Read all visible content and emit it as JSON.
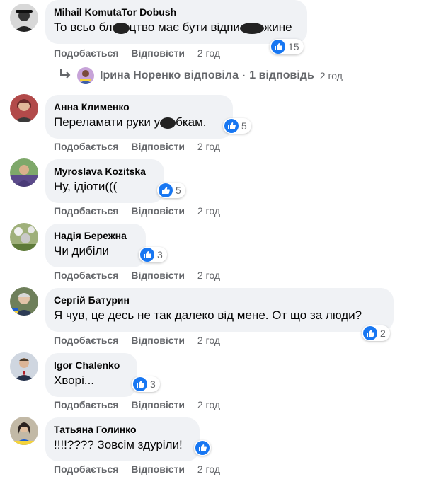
{
  "comments": [
    {
      "author": "Mihail KomutaTor Dobush",
      "text_a": "То всьо бл",
      "text_b": "цтво має бути відпи",
      "text_c": "жине",
      "reactions": "15",
      "like": "Подобається",
      "reply": "Відповісти",
      "time": "2 год"
    },
    {
      "author": "Анна Клименко",
      "text_a": "Переламати руки у",
      "text_b": "бкам.",
      "reactions": "5",
      "like": "Подобається",
      "reply": "Відповісти",
      "time": "2 год"
    },
    {
      "author": "Myroslava Kozitska",
      "text": "Ну, ідіоти(((",
      "reactions": "5",
      "like": "Подобається",
      "reply": "Відповісти",
      "time": "2 год"
    },
    {
      "author": "Надія Бережна",
      "text": "Чи дибіли",
      "reactions": "3",
      "like": "Подобається",
      "reply": "Відповісти",
      "time": "2 год"
    },
    {
      "author": "Сергій Батурин",
      "text": "Я чув, це десь не так далеко від мене. От що за люди?",
      "reactions": "2",
      "like": "Подобається",
      "reply": "Відповісти",
      "time": "2 год"
    },
    {
      "author": "Igor Chalenko",
      "text": "Хворі...",
      "reactions": "3",
      "like": "Подобається",
      "reply": "Відповісти",
      "time": "2 год"
    },
    {
      "author": "Татьяна Голинко",
      "text": "!!!!???? Зовсім здуріли!",
      "like": "Подобається",
      "reply": "Відповісти",
      "time": "2 год"
    }
  ],
  "reply_thread": {
    "name": "Ірина Норенко відповіла",
    "sep": "·",
    "count": "1 відповідь",
    "time": "2 год"
  },
  "colors": {
    "accent": "#1877f2",
    "bubble": "#f0f2f5",
    "meta": "#65676b"
  }
}
